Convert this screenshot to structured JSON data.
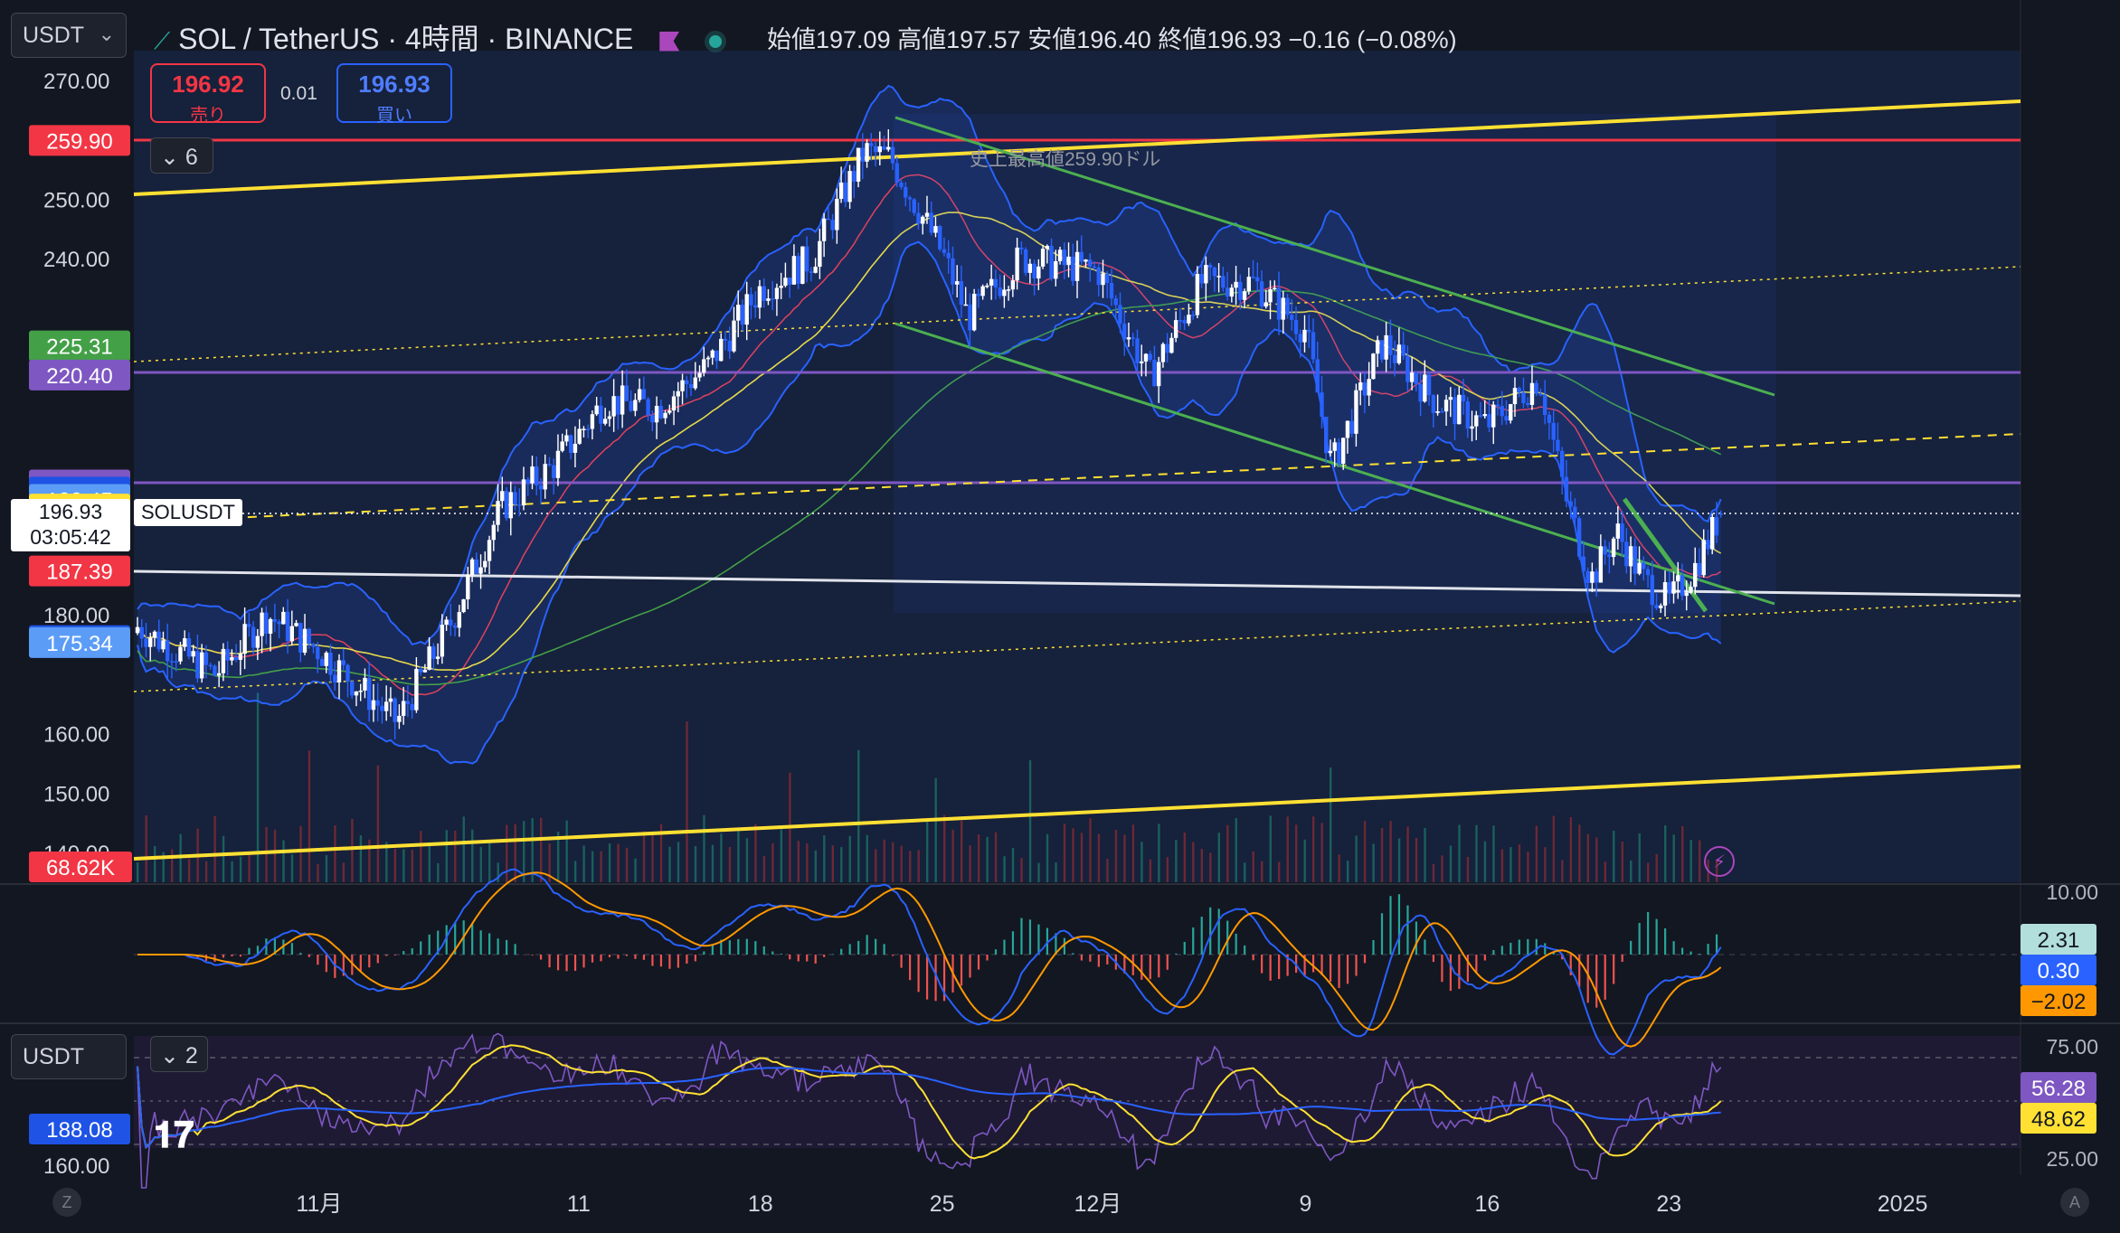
{
  "header": {
    "currency_select": "USDT",
    "title": "SOL / TetherUS · 4時間 · BINANCE",
    "ohlc": {
      "open_label": "始値",
      "open": "197.09",
      "high_label": "高値",
      "high": "197.57",
      "low_label": "安値",
      "low": "196.40",
      "close_label": "終値",
      "close": "196.93",
      "change": "−0.16 (−0.08%)"
    }
  },
  "trade": {
    "sell_price": "196.92",
    "sell_label": "売り",
    "spread": "0.01",
    "buy_price": "196.93",
    "buy_label": "買い"
  },
  "indicators_toggle": "6",
  "oscillator_toggle": "2",
  "annotation": "史上最高値259.90ドル",
  "current": {
    "price": "196.93",
    "countdown": "03:05:42",
    "symbol": "SOLUSDT"
  },
  "colors": {
    "background": "#131722",
    "up": "#ffffff",
    "down": "#2962ff",
    "channel_yellow": "#ffe033",
    "trend_green": "#4caf50",
    "ath_red": "#f23645",
    "level_purple": "#7e57c2",
    "support_white": "#e0e3eb"
  },
  "chart_data": [
    {
      "type": "candlestick",
      "title": "SOL / TetherUS · 4時間 · BINANCE",
      "ylim": [
        140,
        270
      ],
      "price_ticks": [
        "270.00",
        "250.00",
        "240.00",
        "180.00",
        "160.00",
        "150.00",
        "140.00"
      ],
      "axis_tags": [
        {
          "value": "259.90",
          "color": "#f23645"
        },
        {
          "value": "225.31",
          "color": "#43a047"
        },
        {
          "value": "220.40",
          "color": "#7e57c2"
        },
        {
          "value": "201.87",
          "color": "#7e57c2"
        },
        {
          "value": "200.68",
          "color": "#1e53e5"
        },
        {
          "value": "199.45",
          "color": "#5b9cf6"
        },
        {
          "value": "197.82",
          "color": "#ffe033"
        },
        {
          "value": "187.39",
          "color": "#f23645"
        },
        {
          "value": "175.68",
          "color": "#1e53e5"
        },
        {
          "value": "175.34",
          "color": "#5b9cf6"
        }
      ],
      "volume_tag": "68.62K",
      "x_labels": [
        "11月",
        "11",
        "18",
        "25",
        "12月",
        "9",
        "16",
        "23",
        "2025"
      ],
      "x_label_dates": [
        "2024-11-01",
        "2024-11-11",
        "2024-11-18",
        "2024-11-25",
        "2024-12-01",
        "2024-12-09",
        "2024-12-16",
        "2024-12-23",
        "2025-01-01"
      ],
      "close_path": [
        {
          "date": "2024-10-25",
          "close": 178
        },
        {
          "date": "2024-10-28",
          "close": 170
        },
        {
          "date": "2024-10-30",
          "close": 180
        },
        {
          "date": "2024-11-01",
          "close": 174
        },
        {
          "date": "2024-11-04",
          "close": 162
        },
        {
          "date": "2024-11-06",
          "close": 178
        },
        {
          "date": "2024-11-08",
          "close": 198
        },
        {
          "date": "2024-11-10",
          "close": 205
        },
        {
          "date": "2024-11-12",
          "close": 216
        },
        {
          "date": "2024-11-14",
          "close": 215
        },
        {
          "date": "2024-11-16",
          "close": 222
        },
        {
          "date": "2024-11-18",
          "close": 235
        },
        {
          "date": "2024-11-20",
          "close": 240
        },
        {
          "date": "2024-11-22",
          "close": 258
        },
        {
          "date": "2024-11-23",
          "close": 257
        },
        {
          "date": "2024-11-25",
          "close": 241
        },
        {
          "date": "2024-11-26",
          "close": 230
        },
        {
          "date": "2024-11-28",
          "close": 240
        },
        {
          "date": "2024-12-01",
          "close": 238
        },
        {
          "date": "2024-12-03",
          "close": 220
        },
        {
          "date": "2024-12-05",
          "close": 236
        },
        {
          "date": "2024-12-07",
          "close": 236
        },
        {
          "date": "2024-12-09",
          "close": 228
        },
        {
          "date": "2024-12-10",
          "close": 205
        },
        {
          "date": "2024-12-12",
          "close": 226
        },
        {
          "date": "2024-12-14",
          "close": 216
        },
        {
          "date": "2024-12-16",
          "close": 212
        },
        {
          "date": "2024-12-18",
          "close": 220
        },
        {
          "date": "2024-12-19",
          "close": 200
        },
        {
          "date": "2024-12-20",
          "close": 186
        },
        {
          "date": "2024-12-21",
          "close": 194
        },
        {
          "date": "2024-12-22",
          "close": 186
        },
        {
          "date": "2024-12-23",
          "close": 182
        },
        {
          "date": "2024-12-24",
          "close": 188
        },
        {
          "date": "2024-12-25",
          "close": 196.93
        }
      ]
    },
    {
      "type": "line",
      "title": "MACD",
      "right_axis_ticks": [
        "10.00"
      ],
      "value_tags": [
        {
          "value": "2.31",
          "color": "#b2dfdb"
        },
        {
          "value": "0.30",
          "color": "#2962ff"
        },
        {
          "value": "−2.02",
          "color": "#ff9800"
        }
      ]
    },
    {
      "type": "line",
      "title": "RSI",
      "currency_select": "USDT",
      "right_axis_ticks": [
        "75.00",
        "25.00"
      ],
      "left_tags": [
        "188.08",
        "160.00"
      ],
      "value_tags": [
        {
          "value": "56.28",
          "color": "#7e57c2"
        },
        {
          "value": "48.62",
          "color": "#ffe033"
        }
      ]
    }
  ],
  "footer": {
    "left_button": "Z",
    "right_button": "A"
  }
}
